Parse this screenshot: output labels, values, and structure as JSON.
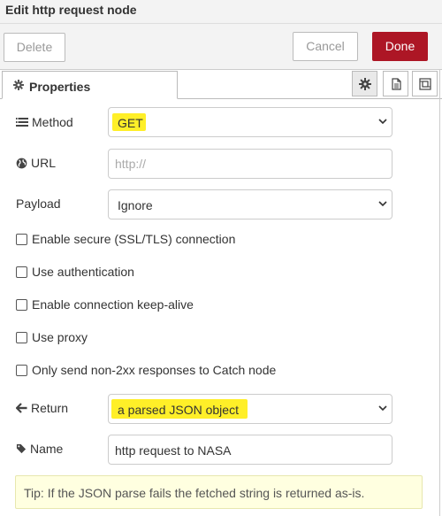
{
  "dialog": {
    "title": "Edit http request node"
  },
  "toolbar": {
    "delete_label": "Delete",
    "cancel_label": "Cancel",
    "done_label": "Done"
  },
  "tabs": {
    "properties_label": "Properties",
    "icon_buttons": [
      "gear-icon",
      "description-icon",
      "appearance-icon"
    ]
  },
  "form": {
    "method": {
      "label": "Method",
      "value": "GET"
    },
    "url": {
      "label": "URL",
      "value": "",
      "placeholder": "http://"
    },
    "payload": {
      "label": "Payload",
      "value": "Ignore"
    },
    "checkboxes": [
      {
        "label": "Enable secure (SSL/TLS) connection",
        "checked": false
      },
      {
        "label": "Use authentication",
        "checked": false
      },
      {
        "label": "Enable connection keep-alive",
        "checked": false
      },
      {
        "label": "Use proxy",
        "checked": false
      },
      {
        "label": "Only send non-2xx responses to Catch node",
        "checked": false
      }
    ],
    "return": {
      "label": "Return",
      "value": "a parsed JSON object"
    },
    "name": {
      "label": "Name",
      "value": "http request to NASA"
    }
  },
  "tip": "Tip: If the JSON parse fails the fetched string is returned as-is.",
  "colors": {
    "done_button": "#ad1625",
    "highlight": "#ffef28",
    "tip_background": "#ffffe0"
  }
}
